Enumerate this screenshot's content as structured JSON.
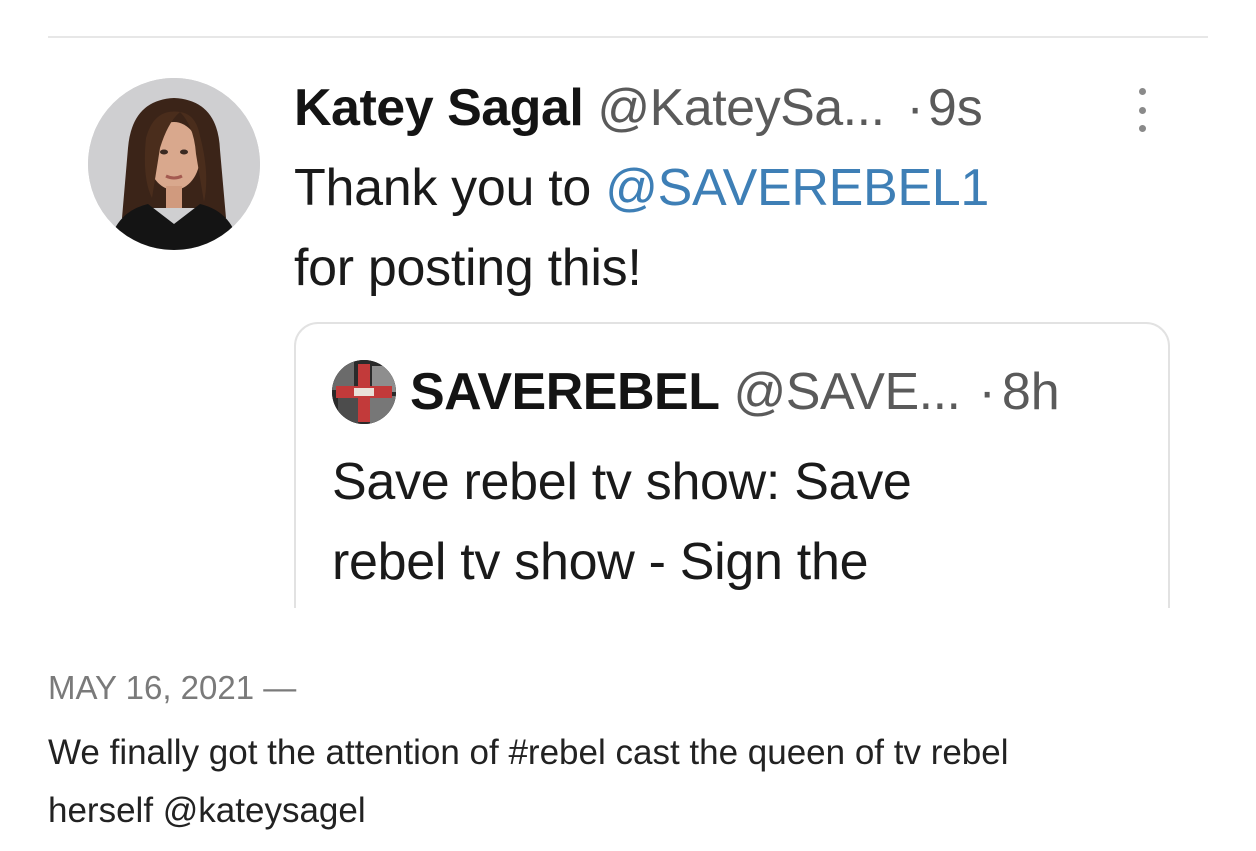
{
  "tweet": {
    "author_name": "Katey Sagal",
    "author_handle": "@KateySa...",
    "time_separator": "·",
    "time_ago": "9s",
    "more_icon": "vertical-ellipsis-icon",
    "body_prefix": "Thank you to ",
    "body_mention": "@SAVEREBEL1",
    "body_suffix": "for posting this!",
    "mention_color": "#3e7fb6",
    "quoted": {
      "author_name": "SAVEREBEL",
      "author_handle": "@SAVE...",
      "time_separator": "·",
      "time_ago": "8h",
      "text_line1": "Save rebel tv show: Save",
      "text_line2": "rebel tv show - Sign the"
    }
  },
  "post": {
    "date": "MAY 16, 2021",
    "date_dash": " —",
    "caption_line1": "We finally got the attention of #rebel cast the queen of tv rebel",
    "caption_line2": "herself @kateysagel"
  }
}
